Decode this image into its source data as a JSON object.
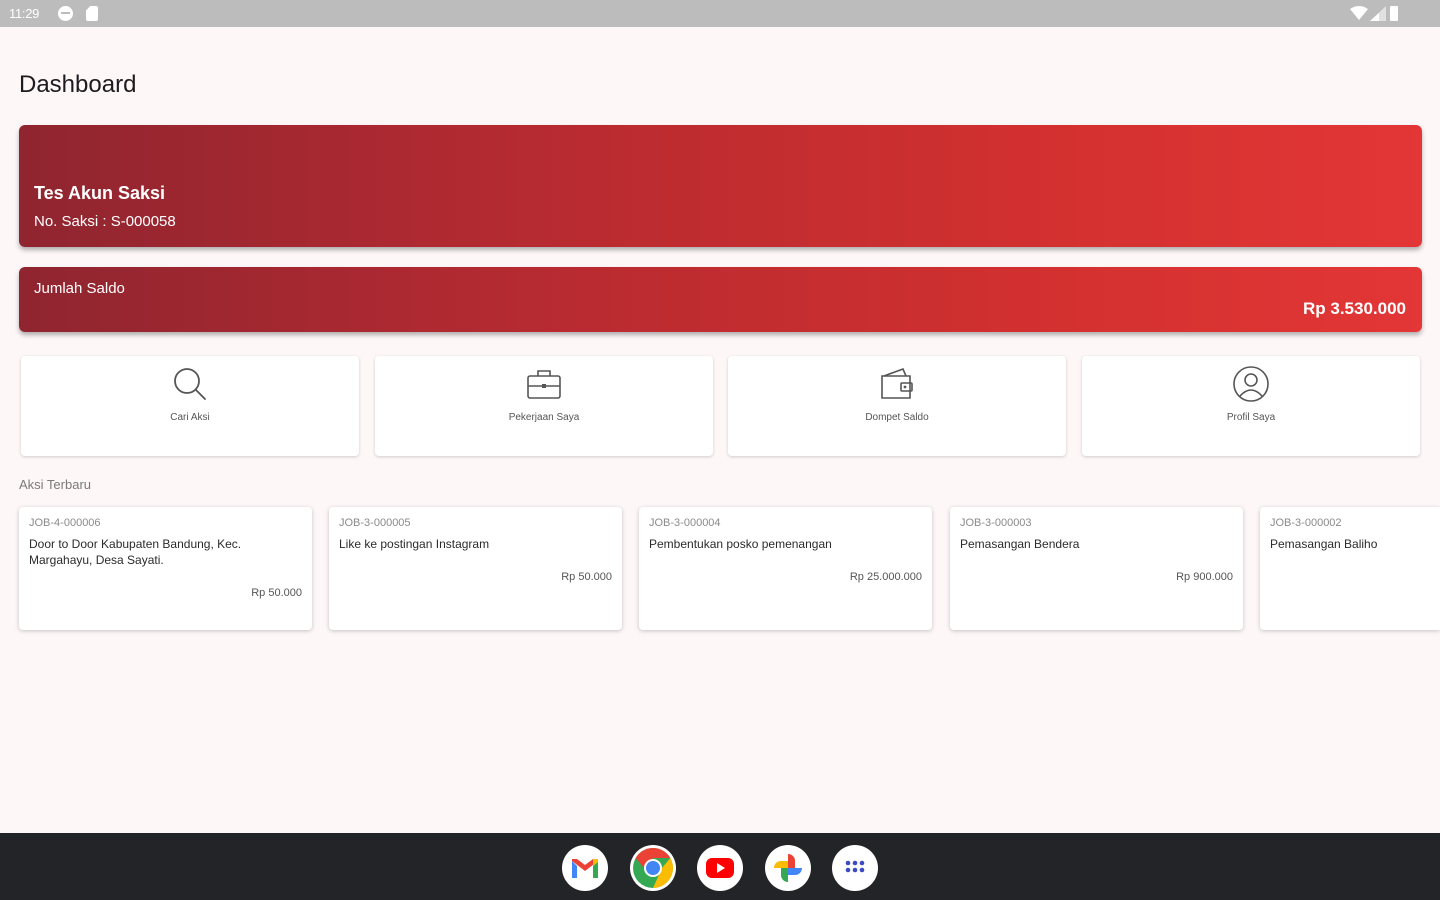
{
  "status_bar": {
    "time": "11:29",
    "icons": [
      "notification-icon",
      "sd-card-icon",
      "wifi-icon",
      "signal-icon",
      "battery-icon"
    ]
  },
  "page": {
    "title": "Dashboard"
  },
  "profile": {
    "name": "Tes Akun Saksi",
    "number": "No. Saksi : S-000058"
  },
  "balance": {
    "label": "Jumlah Saldo",
    "value": "Rp 3.530.000"
  },
  "menu": [
    {
      "label": "Cari Aksi",
      "icon": "search-icon"
    },
    {
      "label": "Pekerjaan Saya",
      "icon": "briefcase-icon"
    },
    {
      "label": "Dompet Saldo",
      "icon": "wallet-icon"
    },
    {
      "label": "Profil Saya",
      "icon": "profile-icon"
    }
  ],
  "recent": {
    "title": "Aksi Terbaru",
    "jobs": [
      {
        "code": "JOB-4-000006",
        "title": "Door to Door Kabupaten Bandung, Kec. Margahayu, Desa Sayati.",
        "price": "Rp 50.000"
      },
      {
        "code": "JOB-3-000005",
        "title": "Like ke postingan Instagram",
        "price": "Rp 50.000"
      },
      {
        "code": "JOB-3-000004",
        "title": "Pembentukan posko pemenangan",
        "price": "Rp 25.000.000"
      },
      {
        "code": "JOB-3-000003",
        "title": "Pemasangan Bendera",
        "price": "Rp 900.000"
      },
      {
        "code": "JOB-3-000002",
        "title": "Pemasangan Baliho",
        "price": ""
      }
    ]
  },
  "dock": [
    {
      "app": "Gmail",
      "icon": "gmail-icon"
    },
    {
      "app": "Chrome",
      "icon": "chrome-icon"
    },
    {
      "app": "YouTube",
      "icon": "youtube-icon"
    },
    {
      "app": "Photos",
      "icon": "photos-icon"
    },
    {
      "app": "App drawer",
      "icon": "app-drawer-icon"
    }
  ],
  "colors": {
    "primary_start": "#8f2530",
    "primary_end": "#e33636",
    "background": "#fdf7f8",
    "nav_bar": "#232427"
  }
}
